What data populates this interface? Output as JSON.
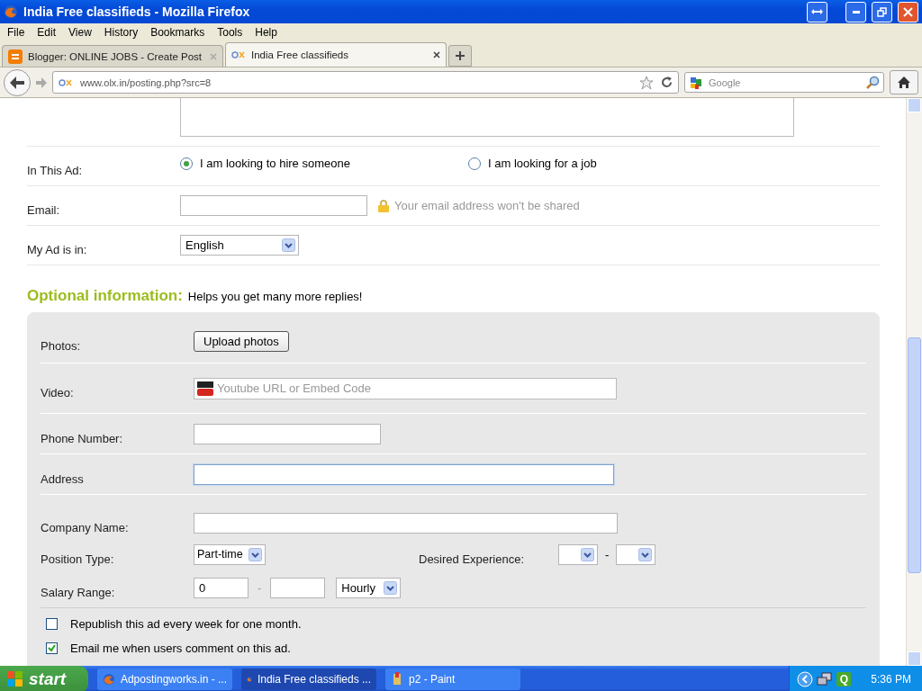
{
  "window": {
    "title": "India Free classifieds - Mozilla Firefox"
  },
  "menu": [
    "File",
    "Edit",
    "View",
    "History",
    "Bookmarks",
    "Tools",
    "Help"
  ],
  "tabs": [
    {
      "label": "Blogger: ONLINE JOBS - Create Post",
      "selected": false,
      "kind": "blogger"
    },
    {
      "label": "India Free classifieds",
      "selected": true,
      "kind": "olx"
    }
  ],
  "address": {
    "url": "www.olx.in/posting.php?src=8"
  },
  "search": {
    "placeholder": "Google"
  },
  "form": {
    "ad_type": {
      "label": "In This Ad:",
      "options": [
        {
          "label": "I am looking to hire someone",
          "selected": true
        },
        {
          "label": "I am looking for a job",
          "selected": false
        }
      ]
    },
    "email": {
      "label": "Email:",
      "hint": "Your email address won't be shared"
    },
    "language": {
      "label": "My Ad is in:",
      "value": "English"
    },
    "optional": {
      "title": "Optional information:",
      "subtitle": "Helps you get many more replies!"
    },
    "photos": {
      "label": "Photos:",
      "button": "Upload photos"
    },
    "video": {
      "label": "Video:",
      "placeholder": "Youtube URL or Embed Code"
    },
    "phone": {
      "label": "Phone Number:"
    },
    "address": {
      "label": "Address",
      "focused": true
    },
    "company": {
      "label": "Company Name:"
    },
    "position": {
      "label": "Position Type:",
      "value": "Part-time"
    },
    "experience": {
      "label": "Desired Experience:",
      "separator": "-"
    },
    "salary": {
      "label": "Salary Range:",
      "min": "0",
      "separator": "-",
      "period": "Hourly"
    },
    "checkboxes": [
      {
        "label": "Republish this ad every week for one month.",
        "checked": false
      },
      {
        "label": "Email me when users comment on this ad.",
        "checked": true
      }
    ]
  },
  "taskbar": {
    "start": "start",
    "tasks": [
      {
        "label": "Adpostingworks.in - ...",
        "selected": false
      },
      {
        "label": "India Free classifieds ...",
        "selected": true
      },
      {
        "label": "p2 - Paint",
        "selected": false,
        "kind": "paint"
      }
    ],
    "tray_app": "Q",
    "clock": "5:36 PM"
  }
}
